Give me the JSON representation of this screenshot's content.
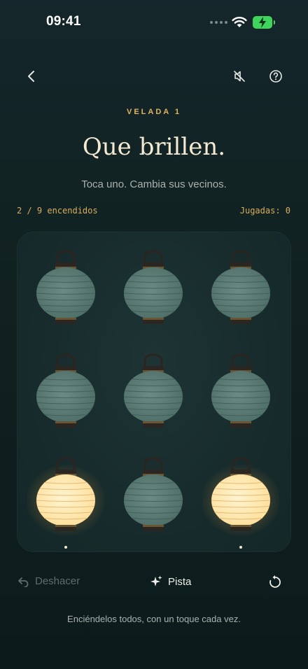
{
  "status": {
    "time": "09:41"
  },
  "header": {
    "eyebrow": "VELADA 1",
    "title": "Que brillen.",
    "subtitle": "Toca uno. Cambia sus vecinos."
  },
  "stats": {
    "lit": "2 / 9 encendidos",
    "moves": "Jugadas: 0"
  },
  "icons": {
    "back": "chevron-left-icon",
    "mute": "speaker-muted-icon",
    "help": "help-icon"
  },
  "grid": {
    "rows": 3,
    "cols": 3,
    "cells": [
      {
        "lit": false
      },
      {
        "lit": false
      },
      {
        "lit": false
      },
      {
        "lit": false
      },
      {
        "lit": false
      },
      {
        "lit": false
      },
      {
        "lit": true
      },
      {
        "lit": false
      },
      {
        "lit": true
      }
    ]
  },
  "actions": {
    "undo": "Deshacer",
    "hint": "Pista"
  },
  "footer": {
    "text": "Enciéndelos todos, con un toque cada vez."
  },
  "colors": {
    "lit": "#ffdf9a",
    "unlit": "#4e6e68",
    "accent": "#e0b560"
  }
}
